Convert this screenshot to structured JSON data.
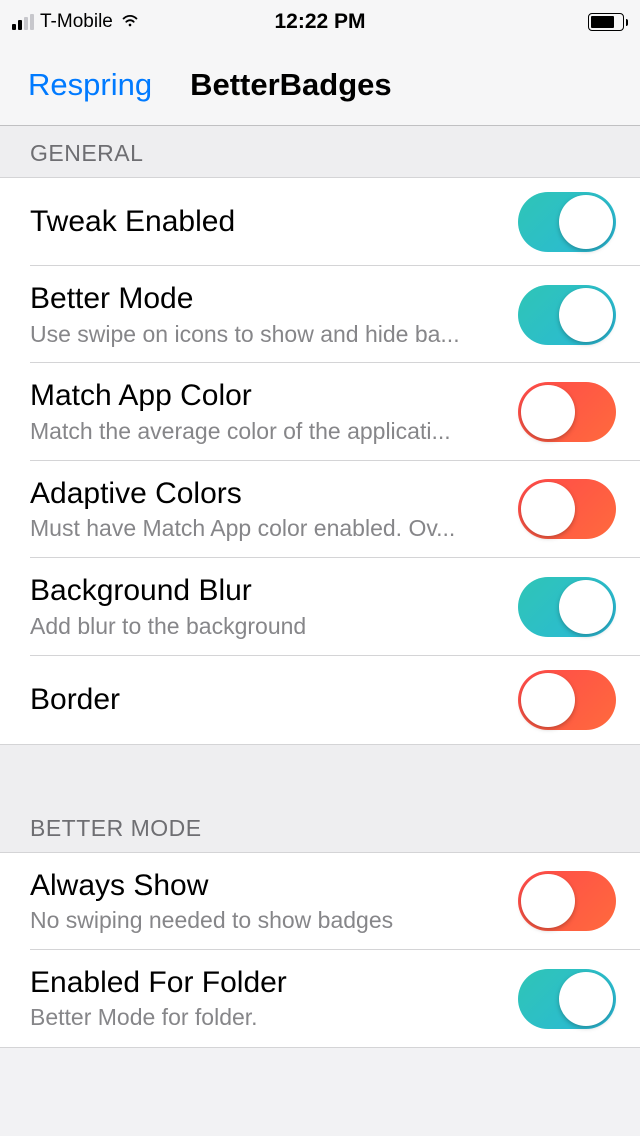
{
  "status": {
    "carrier": "T-Mobile",
    "time": "12:22 PM"
  },
  "nav": {
    "back": "Respring",
    "title": "BetterBadges"
  },
  "sections": [
    {
      "header": "GENERAL",
      "items": [
        {
          "title": "Tweak Enabled",
          "sub": "",
          "style": "teal",
          "knob": "right"
        },
        {
          "title": "Better Mode",
          "sub": "Use swipe on icons to show and hide ba...",
          "style": "teal",
          "knob": "right"
        },
        {
          "title": "Match App Color",
          "sub": "Match the average color of the applicati...",
          "style": "red",
          "knob": "left"
        },
        {
          "title": "Adaptive Colors",
          "sub": "Must have Match App color enabled. Ov...",
          "style": "red",
          "knob": "left"
        },
        {
          "title": "Background Blur",
          "sub": "Add blur to the background",
          "style": "teal",
          "knob": "right"
        },
        {
          "title": "Border",
          "sub": "",
          "style": "red",
          "knob": "left"
        }
      ]
    },
    {
      "header": "BETTER MODE",
      "items": [
        {
          "title": "Always Show",
          "sub": "No swiping needed to show badges",
          "style": "red",
          "knob": "left"
        },
        {
          "title": "Enabled For Folder",
          "sub": "Better Mode for folder.",
          "style": "teal",
          "knob": "right"
        }
      ]
    }
  ]
}
